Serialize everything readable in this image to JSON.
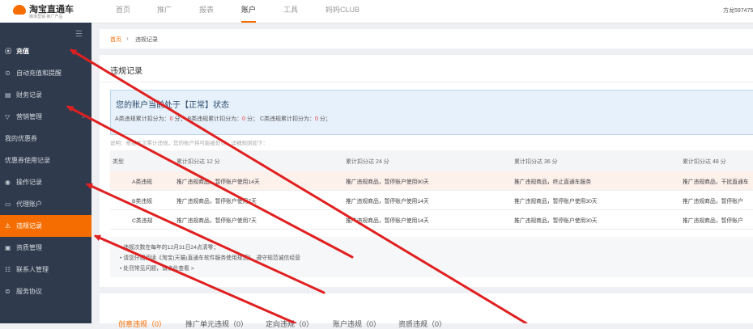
{
  "brand": {
    "title": "淘宝直通车",
    "subtitle": "精准营销 推广产品"
  },
  "top_nav": [
    {
      "label": "首页"
    },
    {
      "label": "推广"
    },
    {
      "label": "报表"
    },
    {
      "label": "账户"
    },
    {
      "label": "工具"
    },
    {
      "label": "妈妈CLUB"
    }
  ],
  "user": {
    "name": "方龙5974750"
  },
  "sidebar": {
    "collapse_icon": "menu-collapse-icon",
    "items": [
      {
        "label": "充值",
        "icon": "recharge-icon"
      },
      {
        "label": "自动充值和提醒",
        "icon": "auto-recharge-icon"
      },
      {
        "label": "财务记录",
        "icon": "finance-icon"
      },
      {
        "label": "营销管理",
        "icon": "marketing-icon"
      },
      {
        "label": "我的优惠券"
      },
      {
        "label": "优惠券使用记录"
      },
      {
        "label": "操作记录",
        "icon": "operation-icon"
      },
      {
        "label": "代理账户",
        "icon": "agent-icon"
      },
      {
        "label": "违规记录",
        "icon": "warning-icon"
      },
      {
        "label": "资质管理",
        "icon": "qualification-icon"
      },
      {
        "label": "联系人管理",
        "icon": "contact-icon"
      },
      {
        "label": "服务协议",
        "icon": "agreement-icon"
      }
    ]
  },
  "breadcrumb": {
    "home": "首页",
    "separator": "›",
    "current": "违规记录"
  },
  "page": {
    "title": "违规记录",
    "status_title": "您的账户当前处于【正常】状态",
    "status": {
      "a_label": "A类违规累计扣分为：",
      "a_value": "0",
      "a_unit": " 分；",
      "b_label": "B类违规累计扣分为：",
      "b_value": "0",
      "b_unit": " 分；",
      "c_label": "C类违规累计扣分为：",
      "c_value": "0",
      "c_unit": " 分；"
    },
    "note": "说明：根据本次累计违规，您的账户将可能被处罚，详细规则如下："
  },
  "table": {
    "headers": [
      "类型",
      "累计扣分达 12 分",
      "累计扣分达 24 分",
      "累计扣分达 36 分",
      "累计扣分达 48 分"
    ],
    "rows": [
      [
        "A类违规",
        "推广违规商品，暂停账户使用14天",
        "推广违规商品，暂停账户使用90天",
        "推广违规商品，终止直通车服务",
        "推广违规商品，干扰直通车"
      ],
      [
        "B类违规",
        "推广违规商品，暂停账户使用7天",
        "推广违规商品，暂停账户使用14天",
        "推广违规商品，暂停账户使用30天",
        "推广违规商品，暂停账户"
      ],
      [
        "C类违规",
        "推广违规商品，暂停账户使用7天",
        "推广违规商品，暂停账户使用14天",
        "推广违规商品，暂停账户使用30天",
        "推广违规商品，暂停账户"
      ]
    ]
  },
  "rules": [
    "违规次数在每年的12月31日24点清零；",
    "请您仔细阅读《淘宝(天猫)直通车软件服务使用规范》，遵守规范诚信经营",
    "处罚常见问题，请点此查看 >"
  ],
  "subtabs": [
    {
      "label": "创意违规（0）"
    },
    {
      "label": "推广单元违规（0）"
    },
    {
      "label": "定向违规（0）"
    },
    {
      "label": "账户违规（0）"
    },
    {
      "label": "资质违规（0）"
    }
  ],
  "colors": {
    "accent": "#f56d00",
    "sidebar": "#2f3a4c",
    "annotation_arrow": "#e02020"
  }
}
